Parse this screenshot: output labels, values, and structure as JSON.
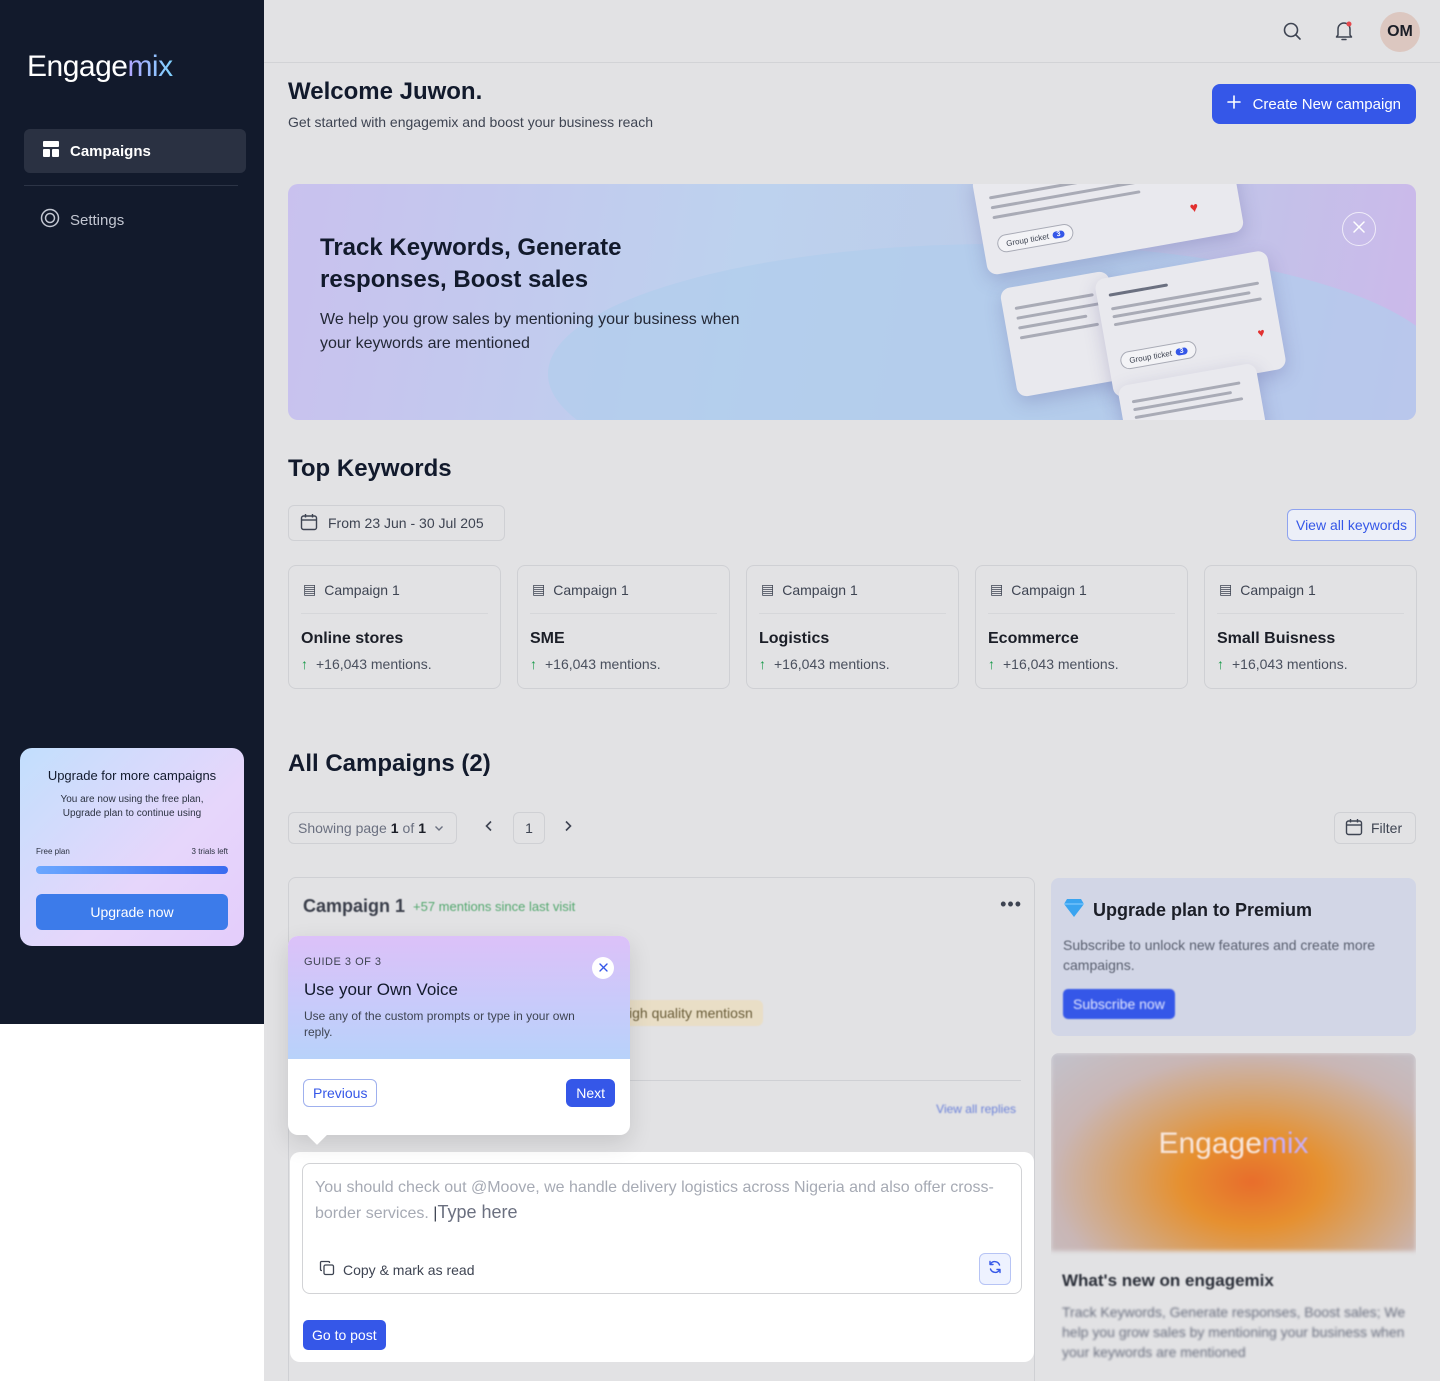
{
  "sidebar": {
    "logo_primary": "Engage",
    "logo_accent": "mix",
    "nav": [
      {
        "label": "Campaigns",
        "icon": "layout-icon",
        "active": true
      },
      {
        "label": "Settings",
        "icon": "gear-icon",
        "active": false
      }
    ],
    "upgrade": {
      "title": "Upgrade for more campaigns",
      "desc_line1": "You are now using the free plan,",
      "desc_line2": "Upgrade plan to continue using",
      "plan_label": "Free plan",
      "trials_label": "3 trials left",
      "button": "Upgrade now"
    }
  },
  "header": {
    "avatar_initials": "OM",
    "has_notification": true
  },
  "welcome": {
    "title": "Welcome Juwon.",
    "subtitle": "Get started with engagemix and boost your business reach",
    "create_button": "Create New campaign"
  },
  "banner": {
    "title": "Track Keywords, Generate responses, Boost sales",
    "text": "We help you grow sales by mentioning your business when your keywords are mentioned",
    "chip_label": "Group ticket",
    "chip_count": "3"
  },
  "top_keywords": {
    "title": "Top Keywords",
    "date_range": "From 23 Jun - 30 Jul 205",
    "view_all": "View all keywords",
    "cards": [
      {
        "campaign": "Campaign 1",
        "keyword": "Online stores",
        "mentions": "+16,043 mentions."
      },
      {
        "campaign": "Campaign 1",
        "keyword": "SME",
        "mentions": "+16,043 mentions."
      },
      {
        "campaign": "Campaign 1",
        "keyword": "Logistics",
        "mentions": "+16,043 mentions."
      },
      {
        "campaign": "Campaign 1",
        "keyword": "Ecommerce",
        "mentions": "+16,043 mentions."
      },
      {
        "campaign": "Campaign 1",
        "keyword": "Small Buisness",
        "mentions": "+16,043 mentions."
      }
    ]
  },
  "all_campaigns": {
    "title": "All Campaigns (2)",
    "pager_prefix": "Showing page",
    "pager_current": "1",
    "pager_of": "of",
    "pager_total": "1",
    "page_number": "1",
    "filter": "Filter",
    "campaign": {
      "title": "Campaign 1",
      "since": "+57 mentions since last visit",
      "quality_tag": "igh quality mentiosn",
      "view_replies": "View all replies"
    }
  },
  "reply": {
    "suggestion": "You should check out @Moove, we handle delivery logistics across Nigeria and also offer cross-border services.",
    "placeholder": "Type here",
    "copy_label": "Copy & mark as read",
    "go_post": "Go to post"
  },
  "guide": {
    "step": "GUIDE 3 OF 3",
    "title": "Use your Own Voice",
    "desc": "Use any of the custom prompts or type in your own reply.",
    "previous": "Previous",
    "next": "Next"
  },
  "premium": {
    "title": "Upgrade plan to Premium",
    "desc": "Subscribe to unlock new features and create more campaigns.",
    "button": "Subscribe now"
  },
  "news": {
    "logo_primary": "Engage",
    "logo_accent": "mix",
    "title": "What's new on engagemix",
    "desc": "Track Keywords, Generate responses, Boost sales; We help you grow sales by mentioning your business when your keywords are mentioned"
  },
  "colors": {
    "primary": "#3557e8",
    "sidebar_bg": "#121a2c",
    "success": "#1a9a4a"
  }
}
